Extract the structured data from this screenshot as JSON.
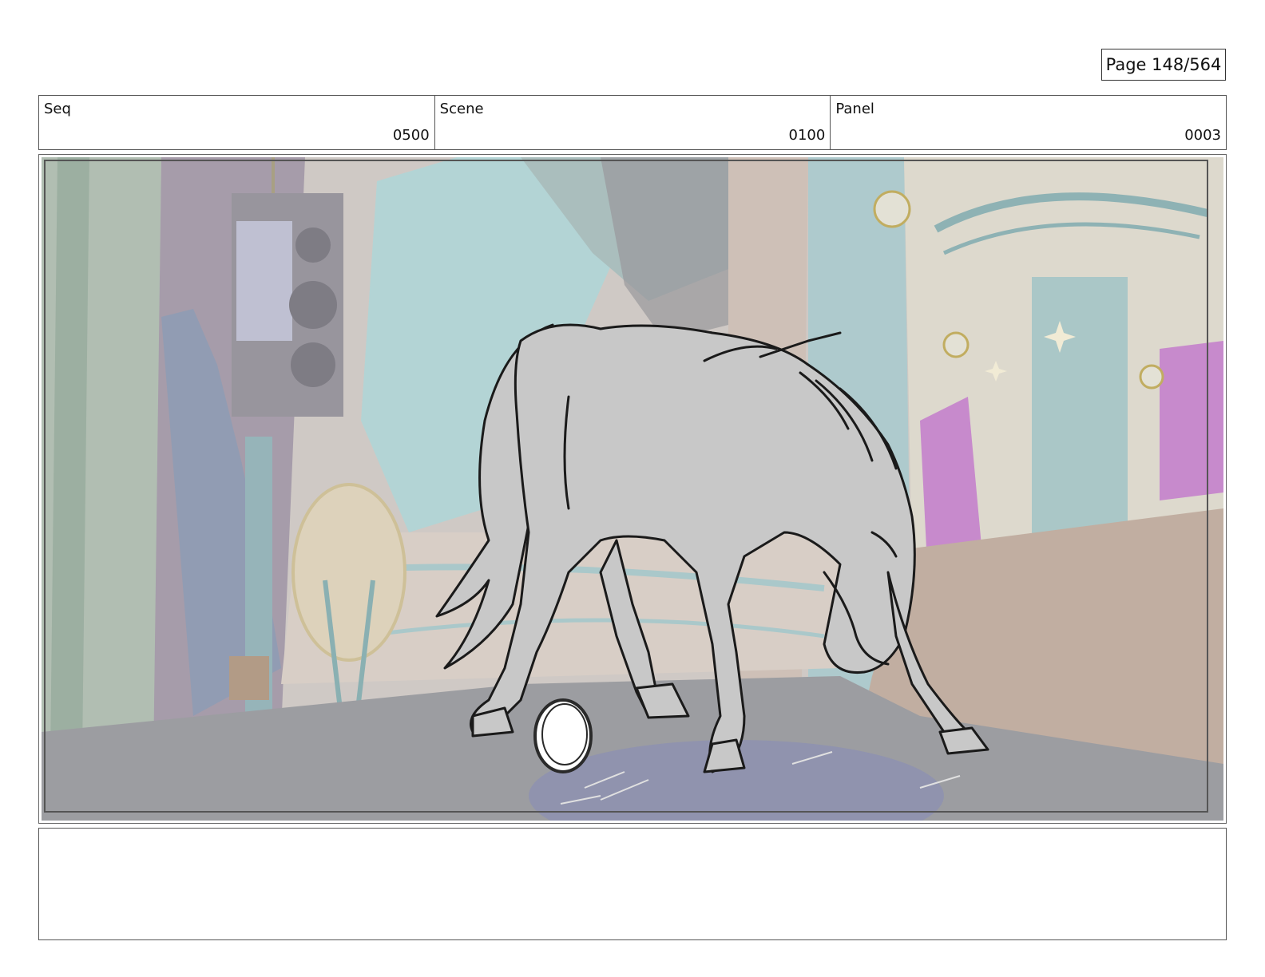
{
  "page": {
    "label": "Page 148/564"
  },
  "header": {
    "seq": {
      "label": "Seq",
      "value": "0500"
    },
    "scene": {
      "label": "Scene",
      "value": "0100"
    },
    "panel": {
      "label": "Panel",
      "value": "0003"
    }
  },
  "notes": {
    "text": ""
  },
  "colors": {
    "wall_teal": "#a9cfd0",
    "floor": "#8f9095",
    "curtain_purple": "#c586c9",
    "horse_fill": "#c8c8c8",
    "sketch_line": "#1a1a1a"
  }
}
